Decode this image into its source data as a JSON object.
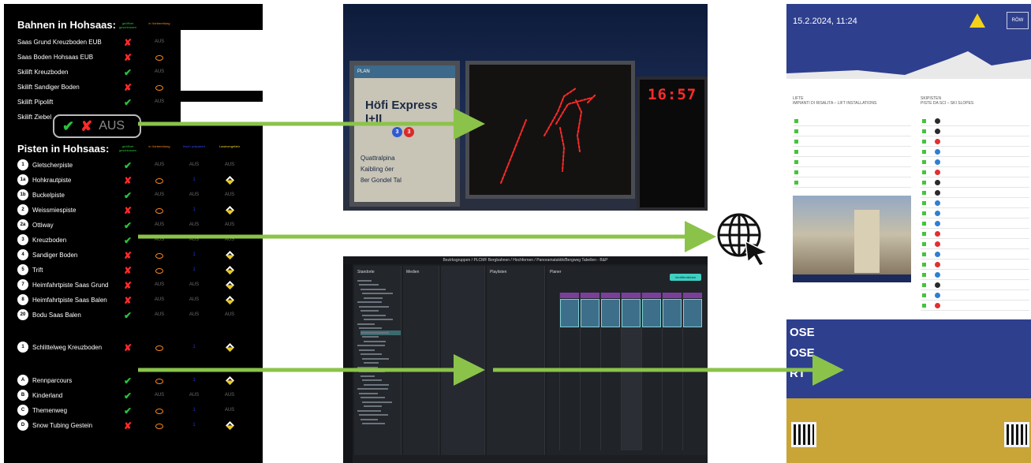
{
  "board": {
    "lifts_title": "Bahnen in Hohsaas:",
    "lifts_col1": "geöffnet geschlossen",
    "lifts_col2": "in Vorbereitung",
    "lifts": [
      {
        "name": "Saas Grund Kreuzboden EUB",
        "status": "closed",
        "col2": "AUS"
      },
      {
        "name": "Saas Boden Hohsaas EUB",
        "status": "closed",
        "col2": "prep"
      },
      {
        "name": "Skilift Kreuzboden",
        "status": "open",
        "col2": "AUS"
      },
      {
        "name": "Skilift Sandiger Boden",
        "status": "closed",
        "col2": "prep"
      },
      {
        "name": "Skilift Pipolift",
        "status": "open",
        "col2": "AUS"
      },
      {
        "name": "Skilift Ziebel",
        "status": "",
        "col2": ""
      }
    ],
    "legend": {
      "ok": "✔",
      "no": "✘",
      "aus": "AUS"
    },
    "pistes_title": "Pisten in Hohsaas:",
    "pistes_col1": "geöffnet geschlossen",
    "pistes_col2": "in Vorbereitung",
    "pistes_col3": "frisch präpariert",
    "pistes_col4": "Lawinengefahr",
    "pistes": [
      {
        "num": "1",
        "name": "Gletscherpiste",
        "status": "open",
        "c2": "AUS",
        "c3": "AUS",
        "c4": "AUS"
      },
      {
        "num": "1a",
        "name": "Hohkrautpiste",
        "status": "closed",
        "c2": "prep",
        "c3": "1",
        "c4": "warn"
      },
      {
        "num": "1b",
        "name": "Buckelpiste",
        "status": "open",
        "c2": "AUS",
        "c3": "AUS",
        "c4": "AUS"
      },
      {
        "num": "2",
        "name": "Weissmiespiste",
        "status": "closed",
        "c2": "prep",
        "c3": "1",
        "c4": "warn"
      },
      {
        "num": "2a",
        "name": "Ottiway",
        "status": "open",
        "c2": "AUS",
        "c3": "AUS",
        "c4": "AUS"
      },
      {
        "num": "3",
        "name": "Kreuzboden",
        "status": "open",
        "c2": "AUS",
        "c3": "AUS",
        "c4": "AUS"
      },
      {
        "num": "4",
        "name": "Sandiger Boden",
        "status": "closed",
        "c2": "prep",
        "c3": "1",
        "c4": "warn"
      },
      {
        "num": "5",
        "name": "Trift",
        "status": "closed",
        "c2": "prep",
        "c3": "1",
        "c4": "warn"
      },
      {
        "num": "7",
        "name": "Heimfahrtpiste Saas Grund",
        "status": "closed",
        "c2": "AUS",
        "c3": "AUS",
        "c4": "warn"
      },
      {
        "num": "8",
        "name": "Heimfahrtpiste Saas Balen",
        "status": "closed",
        "c2": "AUS",
        "c3": "AUS",
        "c4": "warn"
      },
      {
        "num": "20",
        "name": "Bodu Saas Balen",
        "status": "open",
        "c2": "AUS",
        "c3": "AUS",
        "c4": "AUS"
      },
      {
        "num": "1",
        "name": "Schlittelweg Kreuzboden",
        "status": "closed",
        "c2": "prep",
        "c3": "1",
        "c4": "warn"
      },
      {
        "num": "A",
        "name": "Rennparcours",
        "status": "open",
        "c2": "prep",
        "c3": "1",
        "c4": "warn"
      },
      {
        "num": "B",
        "name": "Kinderland",
        "status": "open",
        "c2": "AUS",
        "c3": "AUS",
        "c4": "AUS"
      },
      {
        "num": "C",
        "name": "Themenweg",
        "status": "open",
        "c2": "prep",
        "c3": "1",
        "c4": "AUS"
      },
      {
        "num": "D",
        "name": "Snow Tubing Gestein",
        "status": "closed",
        "c2": "prep",
        "c3": "1",
        "c4": "warn"
      }
    ]
  },
  "photo": {
    "sign_top": "PLAN",
    "sign_title": "Höfi Express I+II",
    "sign_badges": [
      "3",
      "3"
    ],
    "sign_lines": [
      "Quattralpina",
      "Kaibling öer",
      "8er Gondel Tal"
    ],
    "clock": "16:57"
  },
  "editor": {
    "breadcrumb": "Bezirksgruppen / PLCMF Bergbahnen / Hochfernen / Panoramataktik/Bergweg Tabellen - B&P",
    "panel1_title": "Standorte",
    "panel2_title": "Medien",
    "panel3_title": "Playlisten",
    "panel4_title": "Planer",
    "button": "Veröffentlichen"
  },
  "web": {
    "datetime": "15.2.2024, 11:24",
    "logo": "RÖW",
    "lifts_heading": "LIFTE\nIMPIANTI DI RISALITA – LIFT INSTALLATIONS",
    "slopes_heading": "SKIPISTEN\nPISTE DA SCI – SKI SLOPES",
    "blue_lines": [
      "OSE",
      "OSE",
      "RT"
    ]
  },
  "colors": {
    "ok": "#29c23b",
    "no": "#ff2a2a",
    "arrow": "#8bc34a",
    "web_blue": "#2e3f8e",
    "web_gold": "#c9a437"
  }
}
